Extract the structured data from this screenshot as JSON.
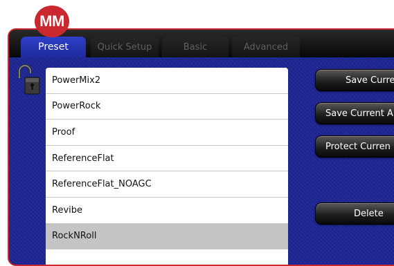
{
  "badge": {
    "text": "MM"
  },
  "tabs": [
    {
      "label": "Preset",
      "active": true
    },
    {
      "label": "Quick Setup",
      "active": false
    },
    {
      "label": "Basic",
      "active": false
    },
    {
      "label": "Advanced",
      "active": false
    }
  ],
  "lock": {
    "icon": "padlock-unlocked-icon"
  },
  "presets": [
    {
      "label": "PowerMix2",
      "selected": false
    },
    {
      "label": "PowerRock",
      "selected": false
    },
    {
      "label": "Proof",
      "selected": false
    },
    {
      "label": "ReferenceFlat",
      "selected": false
    },
    {
      "label": "ReferenceFlat_NOAGC",
      "selected": false
    },
    {
      "label": "Revibe",
      "selected": false
    },
    {
      "label": "RockNRoll",
      "selected": true
    }
  ],
  "buttons": {
    "save_current": "Save Current",
    "save_current_as": "Save Current A",
    "protect_current": "Protect Curren",
    "delete": "Delete"
  },
  "colors": {
    "accent_red": "#c8282e",
    "panel_blue": "#1d2692",
    "active_tab_blue": "#2f3fc8",
    "selected_row": "#c4c4c4"
  }
}
